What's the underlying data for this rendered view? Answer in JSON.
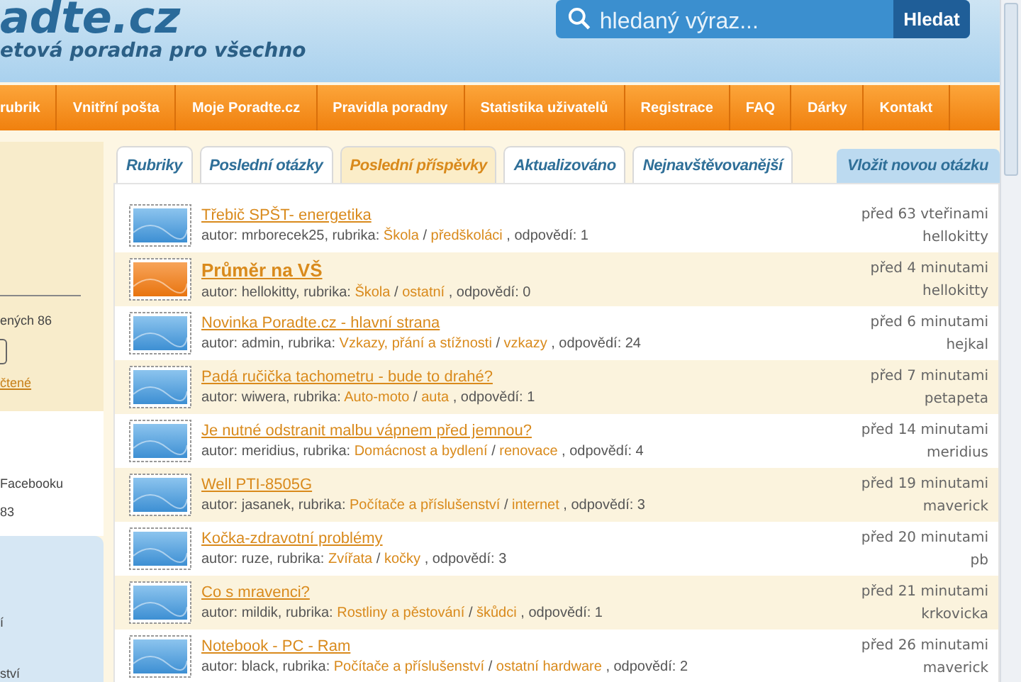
{
  "header": {
    "logo": "adte.cz",
    "tagline": "etová poradna pro všechno",
    "search": {
      "placeholder": "hledaný výraz...",
      "button": "Hledat"
    }
  },
  "nav": [
    "rubrik",
    "Vnitřní pošta",
    "Moje Poradte.cz",
    "Pravidla poradny",
    "Statistika uživatelů",
    "Registrace",
    "FAQ",
    "Dárky",
    "Kontakt"
  ],
  "sidebar": {
    "box_texts": [
      "ených 86"
    ],
    "box_link": "čtené",
    "social_texts": [
      "Facebooku",
      "83"
    ],
    "menu_texts": [
      "í",
      "ství"
    ]
  },
  "tabs": [
    {
      "label": "Rubriky",
      "selected": false
    },
    {
      "label": "Poslední otázky",
      "selected": false
    },
    {
      "label": "Poslední příspěvky",
      "selected": true
    },
    {
      "label": "Aktualizováno",
      "selected": false
    },
    {
      "label": "Nejnavštěvovanější",
      "selected": false
    }
  ],
  "new_question_button": "Vložit novou otázku",
  "posts": [
    {
      "title": "Třebič SPŠT- energetika",
      "highlighted": false,
      "meta": "autor: mrborecek25, rubrika:",
      "category": "Škola",
      "separator": "/",
      "subcategory": "předškoláci",
      "answers": ", odpovědí: 1",
      "time": "před 63 vteřinami",
      "user": "hellokitty"
    },
    {
      "title": "Průměr na VŠ",
      "highlighted": true,
      "meta": "autor: hellokitty, rubrika:",
      "category": "Škola",
      "separator": "/",
      "subcategory": "ostatní",
      "answers": ", odpovědí: 0",
      "time": "před 4 minutami",
      "user": "hellokitty"
    },
    {
      "title": "Novinka Poradte.cz - hlavní strana",
      "highlighted": false,
      "meta": "autor: admin, rubrika:",
      "category": "Vzkazy, přání a stížnosti",
      "separator": "/",
      "subcategory": "vzkazy",
      "answers": ", odpovědí: 24",
      "time": "před 6 minutami",
      "user": "hejkal"
    },
    {
      "title": "Padá ručička tachometru - bude to drahé?",
      "highlighted": false,
      "meta": "autor: wiwera, rubrika:",
      "category": "Auto-moto",
      "separator": "/",
      "subcategory": "auta",
      "answers": ", odpovědí: 1",
      "time": "před 7 minutami",
      "user": "petapeta"
    },
    {
      "title": "Je nutné odstranit malbu vápnem před jemnou?",
      "highlighted": false,
      "meta": "autor: meridius, rubrika:",
      "category": "Domácnost a bydlení",
      "separator": "/",
      "subcategory": "renovace",
      "answers": ", odpovědí: 4",
      "time": "před 14 minutami",
      "user": "meridius"
    },
    {
      "title": "Well PTI-8505G",
      "highlighted": false,
      "meta": "autor: jasanek, rubrika:",
      "category": "Počítače a příslušenství",
      "separator": "/",
      "subcategory": "internet",
      "answers": ", odpovědí: 3",
      "time": "před 19 minutami",
      "user": "maverick"
    },
    {
      "title": "Kočka-zdravotní problémy",
      "highlighted": false,
      "meta": "autor: ruze, rubrika:",
      "category": "Zvířata",
      "separator": "/",
      "subcategory": "kočky",
      "answers": ", odpovědí: 3",
      "time": "před 20 minutami",
      "user": "pb"
    },
    {
      "title": "Co s mravenci?",
      "highlighted": false,
      "meta": "autor: mildik, rubrika:",
      "category": "Rostliny a pěstování",
      "separator": "/",
      "subcategory": "škůdci",
      "answers": ", odpovědí: 1",
      "time": "před 21 minutami",
      "user": "krkovicka"
    },
    {
      "title": "Notebook - PC - Ram",
      "highlighted": false,
      "meta": "autor: black, rubrika:",
      "category": "Počítače a příslušenství",
      "separator": "/",
      "subcategory": "ostatní hardware",
      "answers": ", odpovědí: 2",
      "time": "před 26 minutami",
      "user": "maverick"
    }
  ]
}
